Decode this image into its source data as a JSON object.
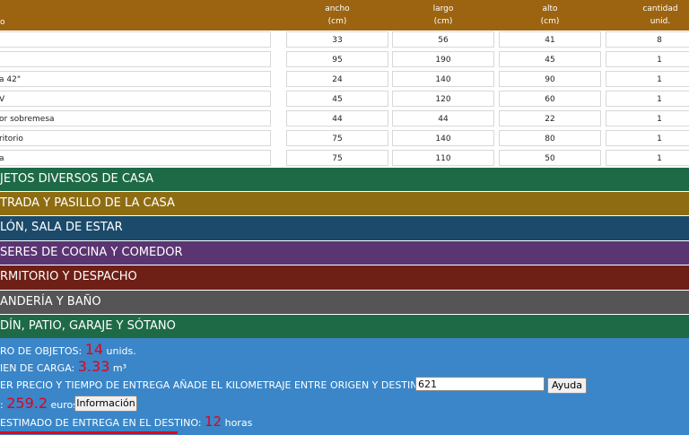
{
  "header": {
    "name_col": "o",
    "columns": [
      {
        "top": "ancho",
        "bottom": "(cm)"
      },
      {
        "top": "largo",
        "bottom": "(cm)"
      },
      {
        "top": "alto",
        "bottom": "(cm)"
      },
      {
        "top": "cantidad",
        "bottom": "unid."
      }
    ]
  },
  "rows": [
    {
      "name": "",
      "ancho": "33",
      "largo": "56",
      "alto": "41",
      "cantidad": "8"
    },
    {
      "name": "",
      "ancho": "95",
      "largo": "190",
      "alto": "45",
      "cantidad": "1"
    },
    {
      "name": "a 42\"",
      "ancho": "24",
      "largo": "140",
      "alto": "90",
      "cantidad": "1"
    },
    {
      "name": "V",
      "ancho": "45",
      "largo": "120",
      "alto": "60",
      "cantidad": "1"
    },
    {
      "name": "or sobremesa",
      "ancho": "44",
      "largo": "44",
      "alto": "22",
      "cantidad": "1"
    },
    {
      "name": "ritorio",
      "ancho": "75",
      "largo": "140",
      "alto": "80",
      "cantidad": "1"
    },
    {
      "name": "a",
      "ancho": "75",
      "largo": "110",
      "alto": "50",
      "cantidad": "1"
    }
  ],
  "sections": [
    {
      "label": "JETOS DIVERSOS DE CASA",
      "color": "#1e6a46"
    },
    {
      "label": "TRADA Y PASILLO DE LA CASA",
      "color": "#8e6d12"
    },
    {
      "label": "LÓN, SALA DE ESTAR",
      "color": "#1c4a6a"
    },
    {
      "label": "SERES DE COCINA Y COMEDOR",
      "color": "#5b3472"
    },
    {
      "label": "RMITORIO Y DESPACHO",
      "color": "#6e1f16"
    },
    {
      "label": "ANDERÍA Y BAÑO",
      "color": "#555555"
    },
    {
      "label": "DÍN, PATIO, GARAJE Y SÓTANO",
      "color": "#1e6a46"
    }
  ],
  "summary": {
    "objects_label": "RO DE OBJETOS:",
    "objects_value": "14",
    "objects_unit": "unids.",
    "volume_label": "IEN DE CARGA:",
    "volume_value": "3.33",
    "volume_unit": "m³",
    "km_label": "ER PRECIO Y TIEMPO DE ENTREGA AÑADE EL KILOMETRAJE ENTRE ORIGEN Y DESTINO",
    "km_value": "621",
    "help_button": "Ayuda",
    "price_prefix": ":",
    "price_value": "259.2",
    "price_unit": "euros",
    "info_button": "Información",
    "time_label": "ESTIMADO DE ENTREGA EN EL DESTINO:",
    "time_value": "12",
    "time_unit": "horas"
  }
}
